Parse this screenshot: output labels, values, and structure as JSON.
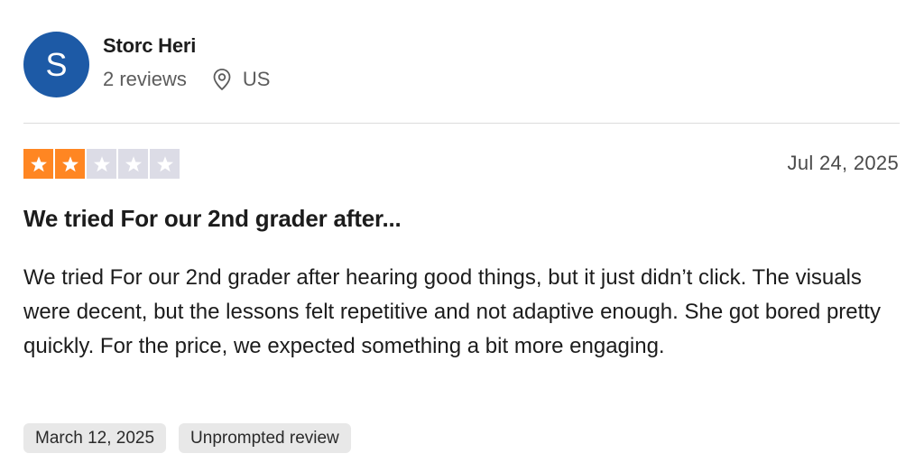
{
  "reviewer": {
    "initial": "S",
    "name": "Storc Heri",
    "reviews_count": "2 reviews",
    "location": "US",
    "avatar_color": "#1d5aa6",
    "location_icon": "location-pin-icon"
  },
  "review": {
    "rating": 2,
    "rating_max": 5,
    "star_color": "#ff8622",
    "date": "Jul 24, 2025",
    "title": "We tried For our 2nd grader after...",
    "body": "We tried For our 2nd grader after hearing good things, but it just didn’t click. The visuals were decent, but the lessons felt repetitive and not adaptive enough. She got bored pretty quickly. For the price, we expected something a bit more engaging.",
    "tags": [
      "March 12, 2025",
      "Unprompted review"
    ]
  }
}
